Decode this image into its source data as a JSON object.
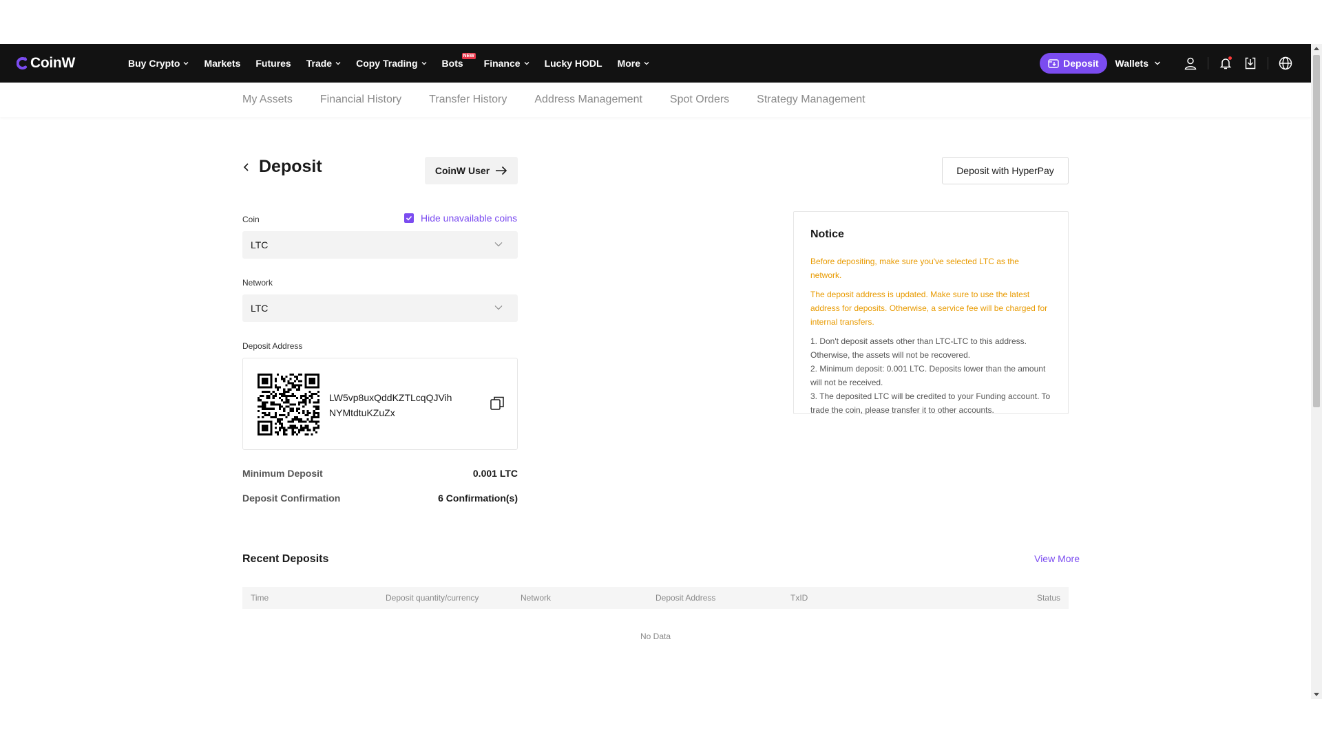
{
  "header": {
    "logo_text": "CoinW",
    "nav": [
      {
        "label": "Buy Crypto",
        "dropdown": true
      },
      {
        "label": "Markets",
        "dropdown": false
      },
      {
        "label": "Futures",
        "dropdown": false
      },
      {
        "label": "Trade",
        "dropdown": true
      },
      {
        "label": "Copy Trading",
        "dropdown": true
      },
      {
        "label": "Bots",
        "dropdown": false,
        "badge": "NEW"
      },
      {
        "label": "Finance",
        "dropdown": true
      },
      {
        "label": "Lucky HODL",
        "dropdown": false
      },
      {
        "label": "More",
        "dropdown": true
      }
    ],
    "deposit_label": "Deposit",
    "wallets_label": "Wallets",
    "accent": "#7b4cf0"
  },
  "subnav": {
    "items": [
      "My Assets",
      "Financial History",
      "Transfer History",
      "Address Management",
      "Spot Orders",
      "Strategy Management"
    ]
  },
  "main": {
    "title": "Deposit",
    "coinw_user_label": "CoinW User",
    "hyperpay_label": "Deposit with HyperPay",
    "coin_label": "Coin",
    "hide_unavailable_label": "Hide unavailable coins",
    "hide_unavailable_checked": true,
    "coin_value": "LTC",
    "network_label": "Network",
    "network_value": "LTC",
    "deposit_address_label": "Deposit Address",
    "deposit_address": "LW5vp8uxQddKZTLcqQJVihNYMtdtuKZuZx",
    "min_deposit_label": "Minimum Deposit",
    "min_deposit_value": "0.001 LTC",
    "confirmation_label": "Deposit Confirmation",
    "confirmation_value": "6 Confirmation(s)"
  },
  "notice": {
    "title": "Notice",
    "warning_1": "Before depositing, make sure you've selected LTC as the network.",
    "warning_2": "The deposit address is updated. Make sure to use the latest address for deposits. Otherwise, a service fee will be charged for internal transfers.",
    "item_1": "1. Don't deposit assets other than LTC-LTC to this address. Otherwise, the assets will not be recovered.",
    "item_2": "2. Minimum deposit: 0.001 LTC. Deposits lower than the amount will not be received.",
    "item_3": "3. The deposited LTC will be credited to your Funding account. To trade the coin, please transfer it to other accounts.",
    "warning_color": "#e89a00"
  },
  "recent": {
    "title": "Recent Deposits",
    "view_more": "View More",
    "columns": [
      "Time",
      "Deposit quantity/currency",
      "Network",
      "Deposit Address",
      "TxID",
      "Status"
    ],
    "empty_text": "No Data"
  }
}
